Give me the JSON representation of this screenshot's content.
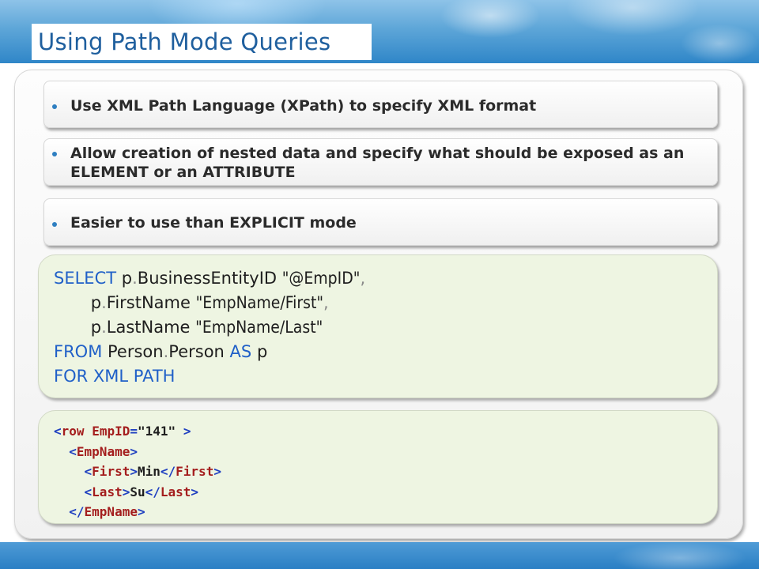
{
  "slide": {
    "title": "Using Path Mode Queries",
    "accent_color": "#1f5f9e",
    "bullet_color": "#2f7fc1"
  },
  "bullets": [
    {
      "text": "Use XML Path Language (XPath) to specify XML format"
    },
    {
      "text": "Allow creation of nested data and specify what should be exposed as an ELEMENT or an ATTRIBUTE"
    },
    {
      "text": "Easier to use than EXPLICIT mode"
    }
  ],
  "sql_code": {
    "line1": {
      "kw": "SELECT",
      "alias": "p",
      "dot": ".",
      "col": "BusinessEntityID",
      "str": "\"@EmpID\"",
      "comma": ","
    },
    "line2": {
      "alias": "p",
      "dot": ".",
      "col": "FirstName",
      "str": "\"EmpName/First\"",
      "comma": ","
    },
    "line3": {
      "alias": "p",
      "dot": ".",
      "col": "LastName",
      "str": "\"EmpName/Last\""
    },
    "line4": {
      "kw1": "FROM",
      "schema": "Person",
      "dot": ".",
      "table": "Person",
      "kw2": "AS",
      "alias": "p"
    },
    "line5": {
      "kw1": "FOR",
      "kw2": "XML",
      "kw3": "PATH"
    }
  },
  "xml_output": {
    "row": {
      "open": "<",
      "tag": "row",
      "attr": "EmpID",
      "eq": "=",
      "value": "\"141\"",
      "close": ">"
    },
    "empname_open": {
      "open": "<",
      "tag": "EmpName",
      "close": ">"
    },
    "first": {
      "open": "<",
      "tag": "First",
      "close": ">",
      "text": "Min",
      "end_open": "</",
      "end_tag": "First",
      "end_close": ">"
    },
    "last": {
      "open": "<",
      "tag": "Last",
      "close": ">",
      "text": "Su",
      "end_open": "</",
      "end_tag": "Last",
      "end_close": ">"
    },
    "empname_close": {
      "open": "</",
      "tag": "EmpName",
      "close": ">"
    }
  }
}
